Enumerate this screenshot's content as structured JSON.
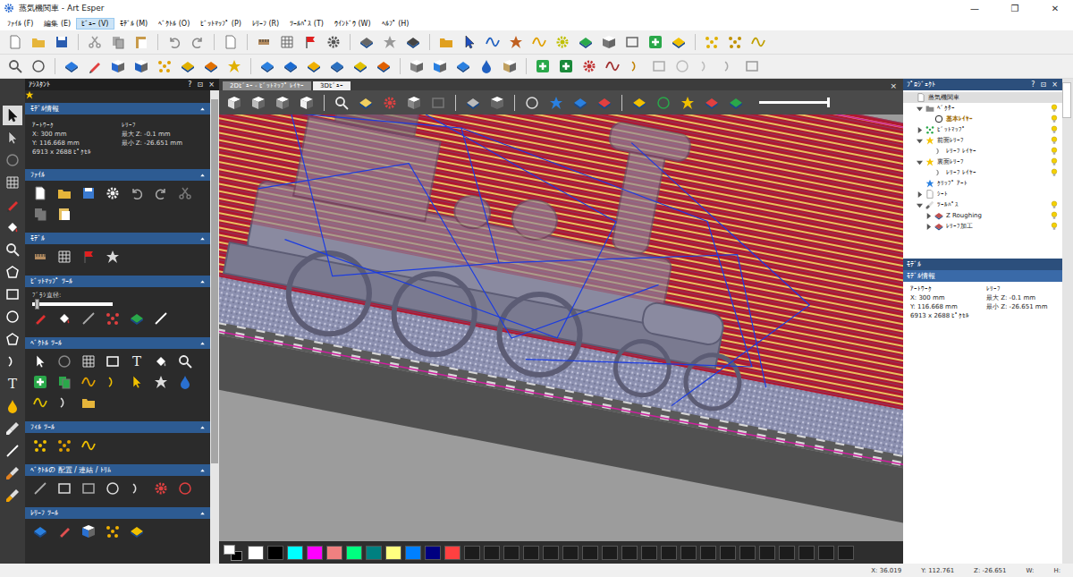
{
  "window": {
    "title": "蒸気機関車 - Art Esper",
    "controls": [
      "—",
      "❐",
      "✕"
    ]
  },
  "menu": [
    {
      "label": "ﾌｧｲﾙ (F)",
      "selected": false
    },
    {
      "label": "編集 (E)",
      "selected": false
    },
    {
      "label": "ﾋﾞｭｰ (V)",
      "selected": true
    },
    {
      "label": "ﾓﾃﾞﾙ (M)",
      "selected": false
    },
    {
      "label": "ﾍﾞｸﾄﾙ (O)",
      "selected": false
    },
    {
      "label": "ﾋﾞｯﾄﾏｯﾌﾟ (P)",
      "selected": false
    },
    {
      "label": "ﾚﾘｰﾌ (R)",
      "selected": false
    },
    {
      "label": "ﾂｰﾙﾊﾟｽ (T)",
      "selected": false
    },
    {
      "label": "ｳｲﾝﾄﾞｳ (W)",
      "selected": false
    },
    {
      "label": "ﾍﾙﾌﾟ (H)",
      "selected": false
    }
  ],
  "text_tool_glyph": "T",
  "left_tools": [
    {
      "selected": true
    },
    {
      "selected": false
    },
    {
      "selected": false
    },
    {
      "selected": false
    },
    {
      "selected": false
    },
    {
      "selected": false
    },
    {
      "selected": false
    },
    {
      "selected": false
    },
    {
      "selected": false
    },
    {
      "selected": false
    },
    {
      "selected": false
    },
    {
      "selected": false
    },
    {
      "selected": false
    },
    {
      "selected": false
    },
    {
      "selected": false
    },
    {
      "selected": false
    },
    {
      "selected": false
    },
    {
      "selected": false
    }
  ],
  "assistant": {
    "title": "ｱｼｽﾀﾝﾄ",
    "controls": [
      "?",
      "⊡",
      "×"
    ],
    "model_info": {
      "heading": "ﾓﾃﾞﾙ情報",
      "left": [
        "ｱｰﾄﾜｰｸ",
        "X: 300 mm",
        "Y: 116.668 mm",
        "6913 x 2688 ﾋﾟｸｾﾙ"
      ],
      "right": [
        "ﾚﾘｰﾌ",
        "最大 Z: -0.1 mm",
        "最小 Z: -26.651 mm"
      ]
    },
    "sections": [
      {
        "title": "ﾌｧｲﾙ"
      },
      {
        "title": "ﾓﾃﾞﾙ"
      },
      {
        "title": "ﾋﾞｯﾄﾏｯﾌﾟ ﾂｰﾙ",
        "slider": {
          "label": "ﾌﾞﾗｼ直径:",
          "level": 0.03
        }
      },
      {
        "title": "ﾍﾞｸﾄﾙ ﾂｰﾙ"
      },
      {
        "title": "ﾌｨﾙ ﾂｰﾙ"
      },
      {
        "title": "ﾍﾞｸﾄﾙの 配置 / 連結 / ﾄﾘﾑ"
      },
      {
        "title": "ﾚﾘｰﾌ ﾂｰﾙ"
      }
    ],
    "scrollbar": {
      "level": 0.8
    }
  },
  "view_tabs": [
    {
      "label": "2Dﾋﾞｭｰ - ﾋﾞｯﾄﾏｯﾌﾟ ﾚｲﾔｰ",
      "selected": false
    },
    {
      "label": "3Dﾋﾞｭｰ",
      "selected": true
    }
  ],
  "view_close": "×",
  "view_zoom": {
    "level": 0.97
  },
  "project": {
    "title": "ﾌﾟﾛｼﾞｪｸﾄ",
    "controls": [
      "?",
      "⊡",
      "×"
    ],
    "items": [
      {
        "label": "蒸気機関車",
        "depth": 0,
        "expandable": false,
        "expanded": true,
        "selected": true,
        "active": false,
        "visible": false
      },
      {
        "label": "ﾍﾞｸﾀｰ",
        "depth": 1,
        "expandable": true,
        "expanded": true,
        "selected": false,
        "active": false,
        "visible": true
      },
      {
        "label": "基本ﾚｲﾔｰ",
        "depth": 2,
        "expandable": false,
        "expanded": false,
        "selected": false,
        "active": true,
        "visible": true
      },
      {
        "label": "ﾋﾞｯﾄﾏｯﾌﾟ",
        "depth": 1,
        "expandable": true,
        "expanded": false,
        "selected": false,
        "active": false,
        "visible": true
      },
      {
        "label": "前面ﾚﾘｰﾌ",
        "depth": 1,
        "expandable": true,
        "expanded": true,
        "selected": false,
        "active": false,
        "visible": true
      },
      {
        "label": "ﾚﾘｰﾌ ﾚｲﾔｰ",
        "depth": 2,
        "expandable": false,
        "expanded": false,
        "selected": false,
        "active": false,
        "visible": true
      },
      {
        "label": "裏面ﾚﾘｰﾌ",
        "depth": 1,
        "expandable": true,
        "expanded": true,
        "selected": false,
        "active": false,
        "visible": true
      },
      {
        "label": "ﾚﾘｰﾌ ﾚｲﾔｰ",
        "depth": 2,
        "expandable": false,
        "expanded": false,
        "selected": false,
        "active": false,
        "visible": true
      },
      {
        "label": "ｸﾘｯﾌﾟ ｱｰﾄ",
        "depth": 1,
        "expandable": false,
        "expanded": false,
        "selected": false,
        "active": false,
        "visible": false
      },
      {
        "label": "ｼｰﾄ",
        "depth": 1,
        "expandable": true,
        "expanded": false,
        "selected": false,
        "active": false,
        "visible": false
      },
      {
        "label": "ﾂｰﾙﾊﾟｽ",
        "depth": 1,
        "expandable": true,
        "expanded": true,
        "selected": false,
        "active": false,
        "visible": true
      },
      {
        "label": "Z Roughing",
        "depth": 2,
        "expandable": true,
        "expanded": false,
        "selected": false,
        "active": false,
        "visible": true
      },
      {
        "label": "ﾚﾘｰﾌ加工",
        "depth": 2,
        "expandable": true,
        "expanded": false,
        "selected": false,
        "active": false,
        "visible": true
      }
    ]
  },
  "model_panel": {
    "title": "ﾓﾃﾞﾙ",
    "heading": "ﾓﾃﾞﾙ情報",
    "left": [
      "ｱｰﾄﾜｰｸ",
      "X: 300 mm",
      "Y: 116.668 mm",
      "6913 x 2688 ﾋﾟｸｾﾙ"
    ],
    "right": [
      "ﾚﾘｰﾌ",
      "最大 Z: -0.1 mm",
      "最小 Z: -26.651 mm"
    ]
  },
  "palette": {
    "current": {
      "fg": "#ffffff",
      "bg": "#000000"
    },
    "swatches": [
      {
        "color": "#ffffff"
      },
      {
        "color": "#000000"
      },
      {
        "color": "#00ffff"
      },
      {
        "color": "#ff00ff"
      },
      {
        "color": "#f08080"
      },
      {
        "color": "#00ff80"
      },
      {
        "color": "#008080"
      },
      {
        "color": "#ffff80"
      },
      {
        "color": "#0080ff"
      },
      {
        "color": "#000080"
      },
      {
        "color": "#ff4040"
      },
      {
        "color": "#1c1c1c"
      },
      {
        "color": "#1c1c1c"
      },
      {
        "color": "#1c1c1c"
      },
      {
        "color": "#1c1c1c"
      },
      {
        "color": "#1c1c1c"
      },
      {
        "color": "#1c1c1c"
      },
      {
        "color": "#1c1c1c"
      },
      {
        "color": "#1c1c1c"
      },
      {
        "color": "#1c1c1c"
      },
      {
        "color": "#1c1c1c"
      },
      {
        "color": "#1c1c1c"
      },
      {
        "color": "#1c1c1c"
      },
      {
        "color": "#1c1c1c"
      },
      {
        "color": "#1c1c1c"
      },
      {
        "color": "#1c1c1c"
      },
      {
        "color": "#1c1c1c"
      },
      {
        "color": "#1c1c1c"
      },
      {
        "color": "#1c1c1c"
      },
      {
        "color": "#1c1c1c"
      },
      {
        "color": "#1c1c1c"
      }
    ]
  },
  "status_bar": [
    "X: 36.019",
    "Y: 112.761",
    "Z: -26.651",
    "W:",
    "H:"
  ]
}
